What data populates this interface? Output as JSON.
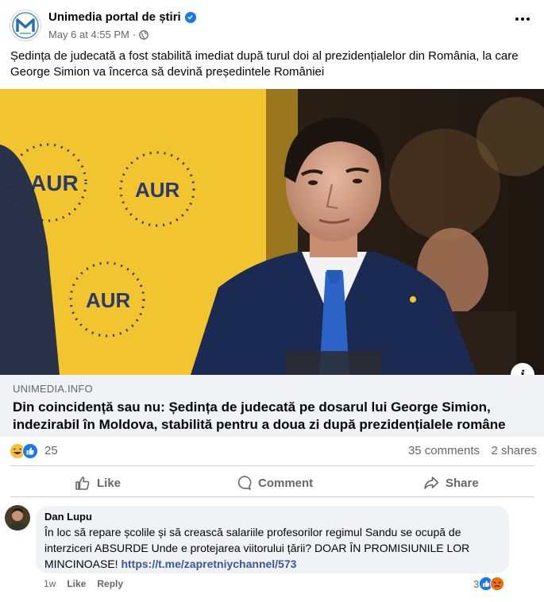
{
  "post": {
    "page_name": "Unimedia portal de știri",
    "timestamp": "May 6 at 4:55 PM",
    "meta_separator": "·",
    "text": "Ședința de judecată a fost stabilită imediat după turul doi al prezidențialelor din România, la care George Simion va încerca să devină președintele României"
  },
  "image": {
    "banner_text_1": "AUR",
    "banner_text_2": "AUR",
    "banner_text_3": "AUR"
  },
  "link": {
    "domain": "UNIMEDIA.INFO",
    "title": "Din coincidență sau nu: Ședința de judecată pe dosarul lui George Simion, indezirabil în Moldova, stabilită pentru a doua zi după prezidențialele române"
  },
  "stats": {
    "reactions": "25",
    "comments": "35 comments",
    "shares": "2 shares"
  },
  "actions": {
    "like": "Like",
    "comment": "Comment",
    "share": "Share"
  },
  "comment": {
    "author": "Dan Lupu",
    "text": "În loc să repare școlile și să crească salariile profesorilor regimul Sandu se ocupă de interziceri ABSURDE Unde e protejarea viitorului țării? DOAR ÎN PROMISIUNILE LOR MINCINOASE!",
    "link": "https://t.me/zapretniychannel/573",
    "age": "1w",
    "like": "Like",
    "reply": "Reply",
    "reaction_count": "3"
  },
  "colors": {
    "accent": "#1877f2",
    "text_secondary": "#65676b",
    "link_box_bg": "#f0f2f5",
    "banner_yellow": "#f2c530"
  }
}
